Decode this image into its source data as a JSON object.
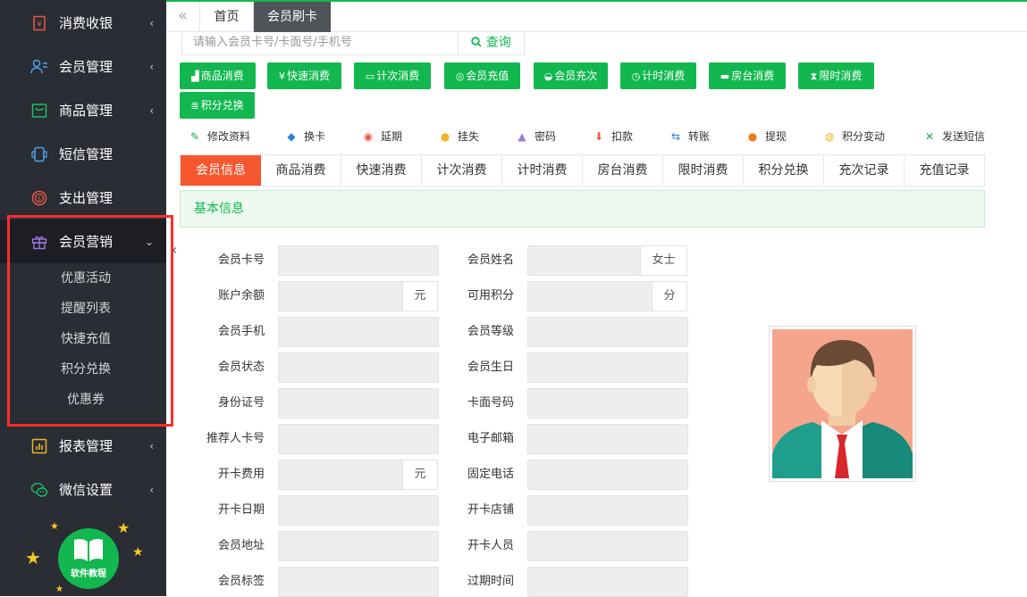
{
  "sidebar": {
    "items": [
      {
        "label": "消费收银",
        "icon": "cashier-icon",
        "chevron": "‹"
      },
      {
        "label": "会员管理",
        "icon": "user-manage-icon",
        "chevron": "‹"
      },
      {
        "label": "商品管理",
        "icon": "goods-icon",
        "chevron": "‹"
      },
      {
        "label": "短信管理",
        "icon": "sms-icon",
        "chevron": ""
      },
      {
        "label": "支出管理",
        "icon": "expense-icon",
        "chevron": ""
      },
      {
        "label": "会员营销",
        "icon": "gift-icon",
        "chevron": "⌄"
      },
      {
        "label": "报表管理",
        "icon": "report-icon",
        "chevron": "‹"
      },
      {
        "label": "微信设置",
        "icon": "wechat-icon",
        "chevron": "‹"
      }
    ],
    "submenu": [
      "优惠活动",
      "提醒列表",
      "快捷充值",
      "积分兑换",
      "优惠券"
    ],
    "tutorial_label": "软件教程"
  },
  "tabs": {
    "prev": "«",
    "home": "首页",
    "current": "会员刷卡"
  },
  "search": {
    "placeholder": "请输入会员卡号/卡面号/手机号",
    "button": "查询"
  },
  "actions": [
    "商品消费",
    "快速消费",
    "计次消费",
    "会员充值",
    "会员充次",
    "计时消费",
    "房台消费",
    "限时消费",
    "积分兑换"
  ],
  "links": [
    "修改资料",
    "换卡",
    "延期",
    "挂失",
    "密码",
    "扣款",
    "转账",
    "提现",
    "积分变动",
    "发送短信"
  ],
  "subtabs": [
    "会员信息",
    "商品消费",
    "快速消费",
    "计次消费",
    "计时消费",
    "房台消费",
    "限时消费",
    "积分兑换",
    "充次记录",
    "充值记录"
  ],
  "section_title": "基本信息",
  "form": {
    "left": [
      {
        "label": "会员卡号",
        "value": "",
        "suffix": ""
      },
      {
        "label": "账户余额",
        "value": "",
        "suffix": "元"
      },
      {
        "label": "会员手机",
        "value": "",
        "suffix": ""
      },
      {
        "label": "会员状态",
        "value": "",
        "suffix": ""
      },
      {
        "label": "身份证号",
        "value": "",
        "suffix": ""
      },
      {
        "label": "推荐人卡号",
        "value": "",
        "suffix": ""
      },
      {
        "label": "开卡费用",
        "value": "",
        "suffix": "元"
      },
      {
        "label": "开卡日期",
        "value": "",
        "suffix": ""
      },
      {
        "label": "会员地址",
        "value": "",
        "suffix": ""
      },
      {
        "label": "会员标签",
        "value": "",
        "suffix": ""
      }
    ],
    "right": [
      {
        "label": "会员姓名",
        "value": "",
        "suffix": "女士"
      },
      {
        "label": "可用积分",
        "value": "",
        "suffix": "分"
      },
      {
        "label": "会员等级",
        "value": "",
        "suffix": ""
      },
      {
        "label": "会员生日",
        "value": "",
        "suffix": ""
      },
      {
        "label": "卡面号码",
        "value": "",
        "suffix": ""
      },
      {
        "label": "电子邮箱",
        "value": "",
        "suffix": ""
      },
      {
        "label": "固定电话",
        "value": "",
        "suffix": ""
      },
      {
        "label": "开卡店铺",
        "value": "",
        "suffix": ""
      },
      {
        "label": "开卡人员",
        "value": "",
        "suffix": ""
      },
      {
        "label": "过期时间",
        "value": "",
        "suffix": ""
      }
    ]
  },
  "colors": {
    "sidebar_bg": "#2a2d34",
    "accent_green": "#12b84f",
    "active_tab": "#f7572f",
    "highlight_border": "#ff2d2d"
  }
}
